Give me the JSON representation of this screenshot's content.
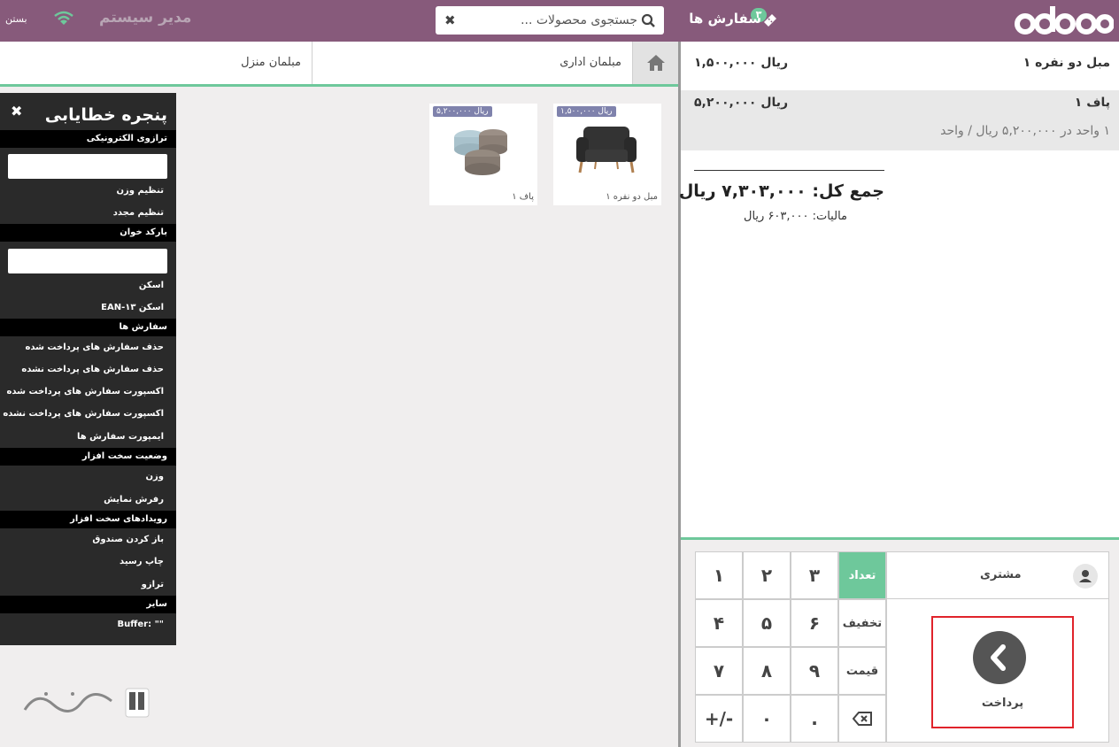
{
  "header": {
    "orders_label": "سفارش ها",
    "orders_count": "۳",
    "search_placeholder": "جستجوی محصولات ...",
    "user_name": "مدیر سیستم",
    "close_label": "بستن"
  },
  "categories": {
    "office": "مبلمان اداری",
    "home": "مبلمان منزل"
  },
  "products": [
    {
      "name": "مبل دو نفره ۱",
      "price": "۱,۵۰۰,۰۰۰ ریال"
    },
    {
      "name": "پاف ۱",
      "price": "۵,۲۰۰,۰۰۰ ریال"
    }
  ],
  "debug": {
    "title": "پنجره خطایابی",
    "scale_section": "ترازوی الکترونیکی",
    "set_weight": "تنظیم وزن",
    "reset": "تنظیم مجدد",
    "barcode_section": "بارکد خوان",
    "scan": "اسکن",
    "scan_ean": "اسکن EAN-۱۳",
    "orders_section": "سفارش ها",
    "delete_paid": "حذف سفارش های پرداخت شده",
    "delete_unpaid": "حذف سفارش های پرداخت نشده",
    "export_paid": "اکسپورت سفارش های پرداخت شده",
    "export_unpaid": "اکسپورت سفارش های پرداخت نشده",
    "import_orders": "ایمپورت سفارش ها",
    "hw_status_section": "وضعیت سخت افزار",
    "weight": "وزن",
    "display_refresh": "رفرش نمایش",
    "hw_events_section": "رویدادهای سخت افزار",
    "open_cashbox": "باز کردن صندوق",
    "print_receipt": "چاپ رسید",
    "scale": "ترازو",
    "other_section": "سایر",
    "buffer": "Buffer: \"\""
  },
  "order": {
    "lines": [
      {
        "name": "مبل دو نفره ۱",
        "price": "۱,۵۰۰,۰۰۰ ریال"
      },
      {
        "name": "پاف ۱",
        "price": "۵,۲۰۰,۰۰۰ ریال",
        "detail": "۱ واحد در ۵,۲۰۰,۰۰۰ ریال / واحد"
      }
    ],
    "total": "جمع کل: ۷,۳۰۳,۰۰۰ ریال",
    "tax": "مالیات: ۶۰۳,۰۰۰ ریال"
  },
  "numpad": {
    "k1": "۱",
    "k2": "۲",
    "k3": "۳",
    "k4": "۴",
    "k5": "۵",
    "k6": "۶",
    "k7": "۷",
    "k8": "۸",
    "k9": "۹",
    "kminus": "+/-",
    "k0": "۰",
    "kdot": ".",
    "qty": "تعداد",
    "disc": "تخفیف",
    "price": "قیمت"
  },
  "actionpad": {
    "customer": "مشتری",
    "payment": "پرداخت"
  },
  "colors": {
    "header": "#875a7b",
    "accent": "#6ec89b",
    "price_tag": "#7f82ac",
    "highlight_border": "#e0232b"
  },
  "icons": [
    "ticket-icon",
    "search-icon",
    "clear-icon",
    "wifi-icon",
    "home-icon",
    "close-icon",
    "user-icon",
    "chevron-left-icon",
    "backspace-icon"
  ]
}
